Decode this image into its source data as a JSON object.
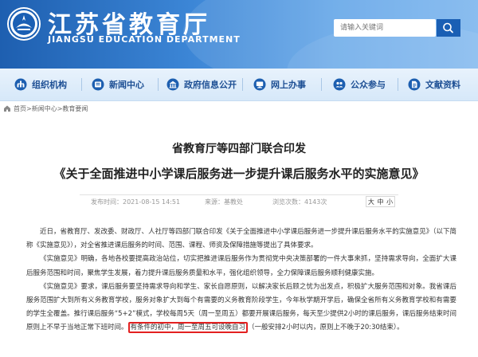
{
  "header": {
    "title": "江苏省教育厅",
    "subtitle": "JIANGSU EDUCATION DEPARTMENT",
    "search_placeholder": "请输入关键词"
  },
  "nav": {
    "items": [
      {
        "label": "组织机构",
        "icon": "org-icon"
      },
      {
        "label": "新闻中心",
        "icon": "news-icon"
      },
      {
        "label": "政府信息公开",
        "icon": "gov-info-icon"
      },
      {
        "label": "网上办事",
        "icon": "online-service-icon"
      },
      {
        "label": "公众参与",
        "icon": "public-participation-icon"
      },
      {
        "label": "文献资料",
        "icon": "documents-icon"
      }
    ]
  },
  "breadcrumb": {
    "items": [
      "首页",
      "新闻中心",
      "教育要闻"
    ],
    "separator": " > "
  },
  "article": {
    "title": "省教育厅等四部门联合印发",
    "doc_title": "《关于全面推进中小学课后服务进一步提升课后服务水平的实施意见》",
    "meta": {
      "date": "发布时间：2021-08-15 14:51",
      "source": "来源：基教处",
      "views": "浏览次数：4143次"
    },
    "font_sizes": [
      "大",
      "中",
      "小"
    ],
    "paragraphs": [
      "近日，省教育厅、发改委、财政厅、人社厅等四部门联合印发《关于全面推进中小学课后服务进一步提升课后服务水平的实施意见》（以下简称《实施意见》），对全省推进课后服务的时间、范围、课程、师资及保障措施等提出了具体要求。",
      "《实施意见》明确，各地各校要提高政治站位，切实把推进课后服务作为贯彻党中央决策部署的一件大事来抓，坚持需求导向，全面扩大课后服务范围和时间，聚焦学生发展，着力提升课后服务质量和水平，强化组织领导，全力保障课后服务顺利健康实施。"
    ],
    "paragraph3_before": "《实施意见》要求，课后服务要坚持需求导向和学生、家长自愿原则，以解决家长后顾之忧为出发点，积极扩大服务范围和对象。我省课后服务范围扩大到所有义务教育学校，服务对象扩大到每个有需要的义务教育阶段学生，今年秋学期开学后，确保全省所有义务教育学校和有需要的学生全覆盖。推行课后服务“5+2”模式，学校每周5天（周一至周五）都要开展课后服务，每天至少提供2小时的课后服务，课后服务结束时间原则上不早于当地正常下班时间。",
    "paragraph3_highlight": "有条件的初中，周一至周五可设晚自习",
    "paragraph3_after": "（一般安排2小时以内，原则上不晚于20:30结束）。"
  }
}
